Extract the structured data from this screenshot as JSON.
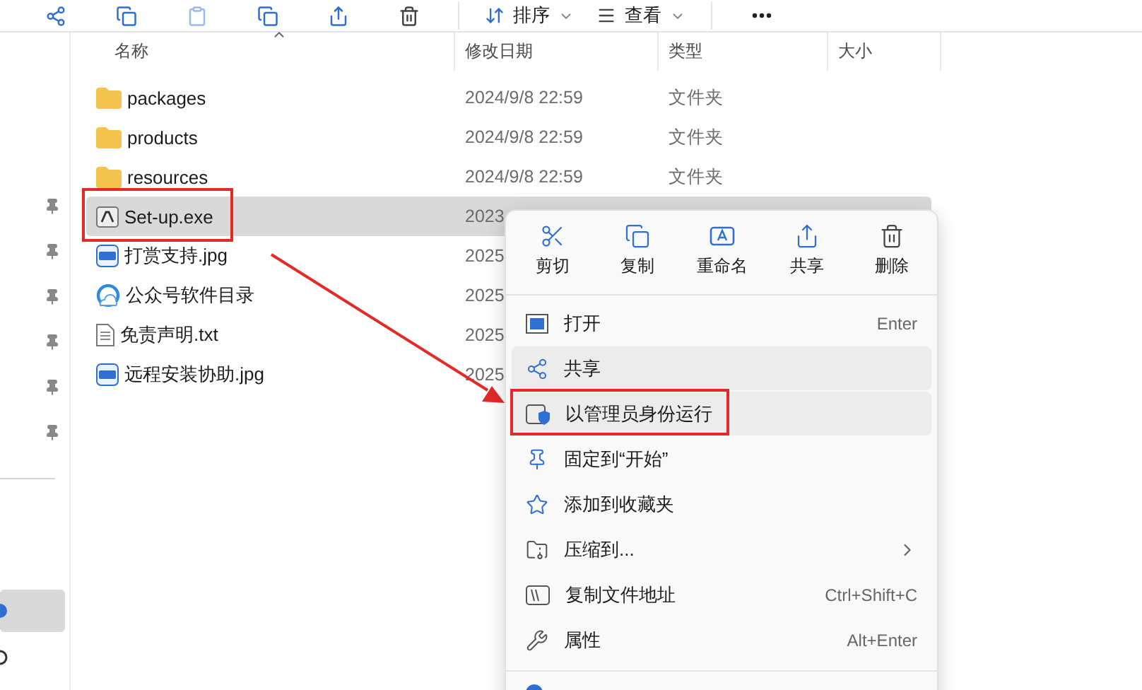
{
  "toolbar": {
    "sort_label": "排序",
    "view_label": "查看"
  },
  "columns": [
    "名称",
    "修改日期",
    "类型",
    "大小"
  ],
  "files": [
    {
      "kind": "folder",
      "name": "packages",
      "date": "2024/9/8 22:59",
      "type": "文件夹",
      "selected": false,
      "annotated": false
    },
    {
      "kind": "folder",
      "name": "products",
      "date": "2024/9/8 22:59",
      "type": "文件夹",
      "selected": false,
      "annotated": false
    },
    {
      "kind": "folder",
      "name": "resources",
      "date": "2024/9/8 22:59",
      "type": "文件夹",
      "selected": false,
      "annotated": false
    },
    {
      "kind": "exe",
      "name": "Set-up.exe",
      "date": "2023",
      "selected": true,
      "annotated": true
    },
    {
      "kind": "jpg",
      "name": "打赏支持.jpg",
      "date": "2025",
      "selected": false,
      "annotated": false
    },
    {
      "kind": "shortcut",
      "name": "公众号软件目录",
      "date": "2025",
      "selected": false,
      "annotated": false
    },
    {
      "kind": "txt",
      "name": "免责声明.txt",
      "date": "2025",
      "selected": false,
      "annotated": false
    },
    {
      "kind": "jpg",
      "name": "远程安装协助.jpg",
      "date": "2025",
      "selected": false,
      "annotated": false
    }
  ],
  "sidebar": {
    "selected_item": true
  },
  "context_menu": {
    "quick_actions": [
      {
        "kind": "cut",
        "label": "剪切"
      },
      {
        "kind": "copy",
        "label": "复制"
      },
      {
        "kind": "rename",
        "label": "重命名"
      },
      {
        "kind": "share",
        "label": "共享"
      },
      {
        "kind": "delete",
        "label": "删除"
      }
    ],
    "items": [
      {
        "kind": "open",
        "label": "打开",
        "shortcut": "Enter",
        "highlighted": false,
        "annotated": false
      },
      {
        "kind": "share",
        "label": "共享",
        "highlighted": true,
        "annotated": false
      },
      {
        "kind": "admin",
        "label": "以管理员身份运行",
        "highlighted": true,
        "annotated": true
      },
      {
        "kind": "pin",
        "label": "固定到“开始”",
        "highlighted": false,
        "annotated": false
      },
      {
        "kind": "star",
        "label": "添加到收藏夹",
        "highlighted": false,
        "annotated": false
      },
      {
        "kind": "zip",
        "label": "压缩到...",
        "submenu": true,
        "highlighted": false,
        "annotated": false
      },
      {
        "kind": "path",
        "label": "复制文件地址",
        "shortcut": "Ctrl+Shift+C",
        "highlighted": false,
        "annotated": false
      },
      {
        "kind": "props",
        "label": "属性",
        "shortcut": "Alt+Enter",
        "highlighted": false,
        "annotated": false
      }
    ]
  }
}
